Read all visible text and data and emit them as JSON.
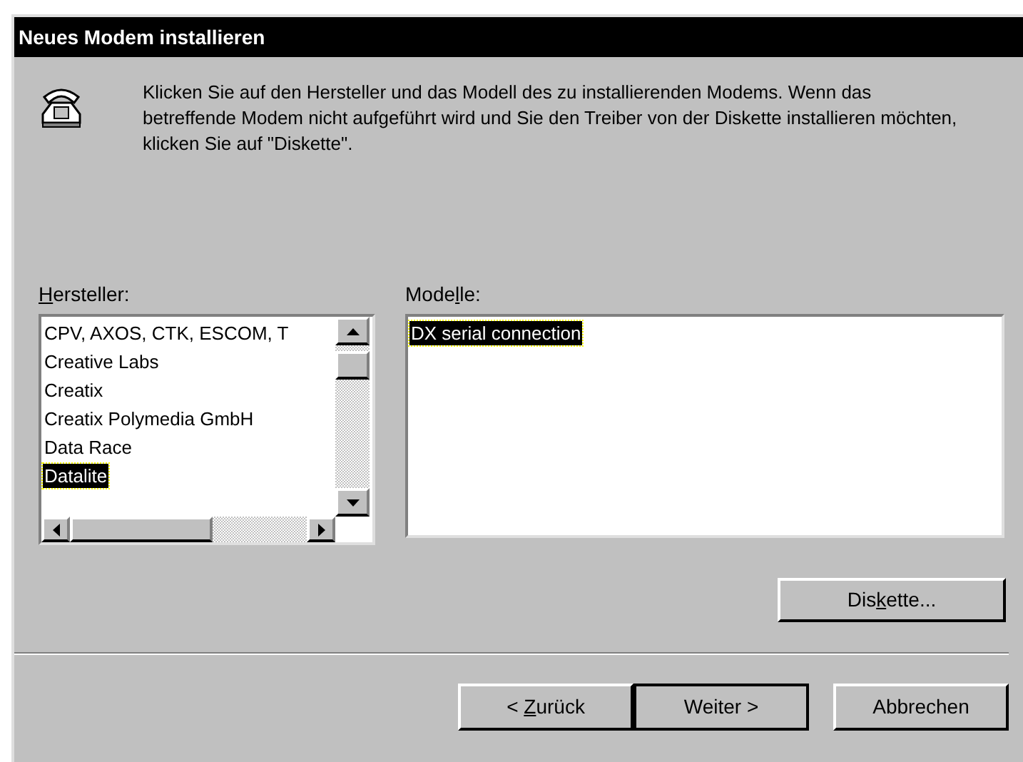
{
  "window": {
    "title": "Neues Modem installieren"
  },
  "instruction": "Klicken Sie auf den Hersteller und das Modell des zu installierenden Modems. Wenn das betreffende Modem nicht aufgeführt wird und Sie den Treiber von der Diskette installieren möchten, klicken Sie auf \"Diskette\".",
  "manufacturers": {
    "label": {
      "key": "H",
      "post": "ersteller:"
    },
    "items": [
      {
        "text": "CPV, AXOS, CTK, ESCOM, T",
        "selected": false
      },
      {
        "text": "Creative Labs",
        "selected": false
      },
      {
        "text": "Creatix",
        "selected": false
      },
      {
        "text": "Creatix Polymedia GmbH",
        "selected": false
      },
      {
        "text": "Data Race",
        "selected": false
      },
      {
        "text": "Datalite",
        "selected": true
      }
    ]
  },
  "models": {
    "label": {
      "pre": "Mode",
      "key": "l",
      "post": "le:"
    },
    "items": [
      {
        "text": "DX serial connection",
        "selected": true
      }
    ]
  },
  "disk_button": {
    "pre": "Dis",
    "key": "k",
    "post": "ette..."
  },
  "buttons": [
    {
      "pre": "< ",
      "key": "Z",
      "post": "urück",
      "default": false
    },
    {
      "pre": "Weiter >",
      "default": true
    },
    {
      "pre": "Abbrechen",
      "default": false
    }
  ]
}
